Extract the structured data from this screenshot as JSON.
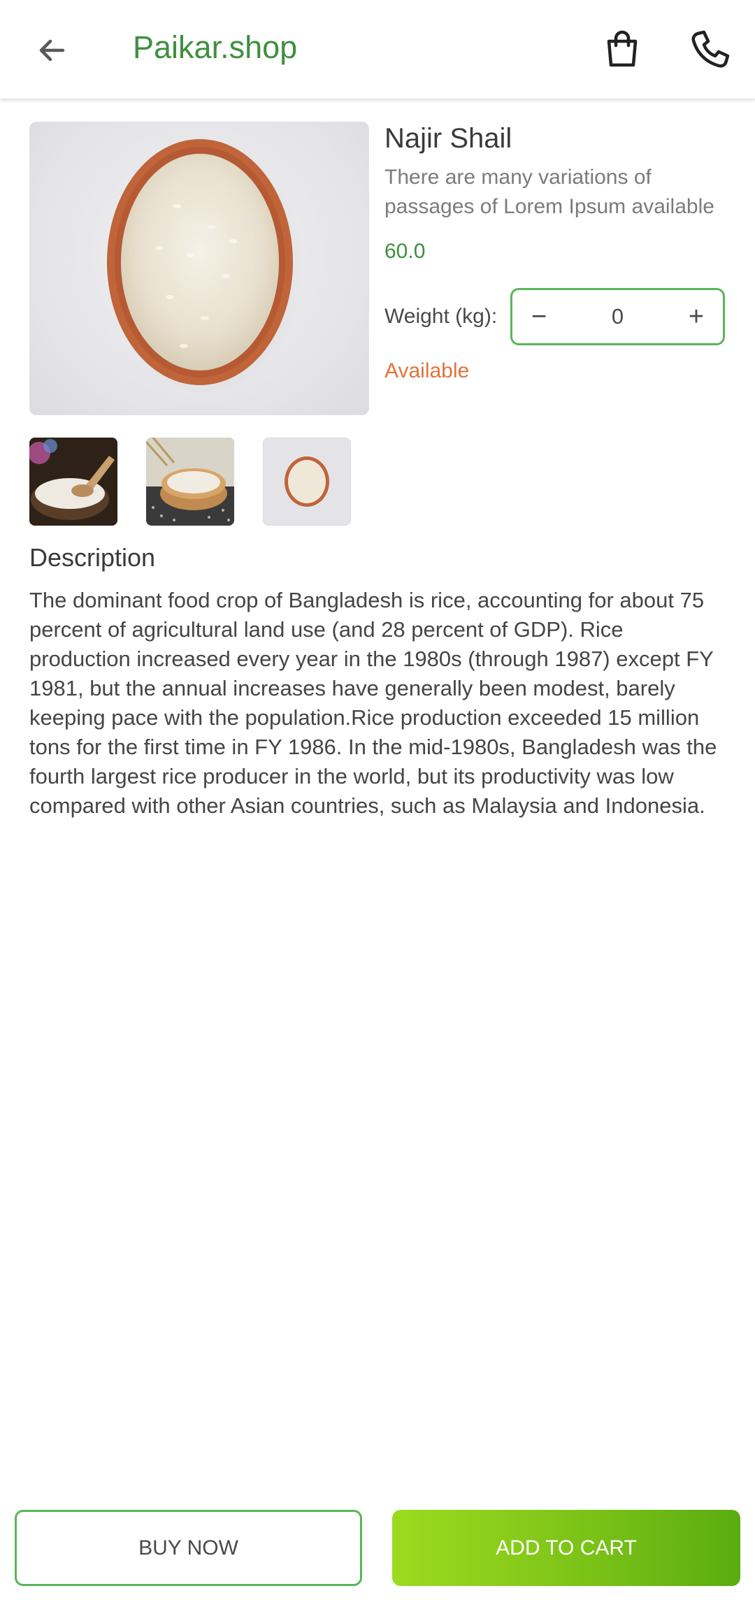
{
  "header": {
    "title": "Paikar.shop",
    "back_icon": "arrow-left-icon",
    "cart_icon": "shopping-bag-icon",
    "call_icon": "phone-icon"
  },
  "product": {
    "name": "Najir Shail",
    "subtitle": "There are many variations of passages of Lorem Ipsum available",
    "price": "60.0",
    "weight_label": "Weight (kg):",
    "quantity": "0",
    "decrement_symbol": "−",
    "increment_symbol": "+",
    "availability": "Available"
  },
  "description": {
    "title": "Description",
    "body": "The dominant food crop of Bangladesh is rice, accounting for about 75 percent of agricultural land use (and 28 percent of GDP). Rice production increased every year in the 1980s (through 1987) except FY 1981, but the annual increases have generally been modest, barely keeping pace with the population.Rice production exceeded 15 million tons for the first time in FY 1986. In the mid-1980s, Bangladesh was the fourth largest rice producer in the world, but its productivity was low compared with other Asian countries, such as Malaysia and Indonesia."
  },
  "actions": {
    "buy_now": "BUY NOW",
    "add_to_cart": "ADD TO CART"
  },
  "colors": {
    "brand_green": "#3f8f3f",
    "accent_green": "#5ab55a",
    "available_orange": "#e0733a",
    "cart_gradient_start": "#9cdb1f",
    "cart_gradient_end": "#5aac10"
  }
}
